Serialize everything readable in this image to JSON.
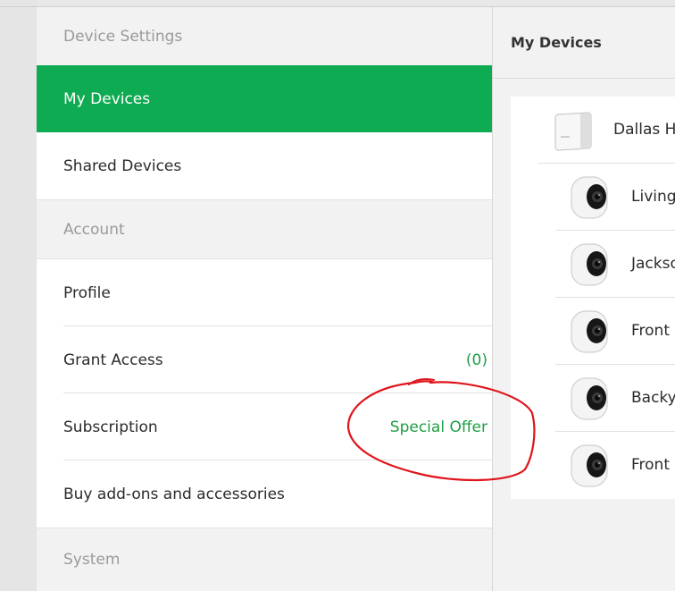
{
  "settings": {
    "sections": [
      {
        "title": "Device Settings"
      },
      {
        "title": "Account"
      },
      {
        "title": "System"
      }
    ],
    "device_items": [
      {
        "label": "My Devices",
        "active": true
      },
      {
        "label": "Shared Devices",
        "active": false
      }
    ],
    "account_items": [
      {
        "label": "Profile",
        "value": ""
      },
      {
        "label": "Grant Access",
        "value": "(0)"
      },
      {
        "label": "Subscription",
        "value": "Special Offer"
      },
      {
        "label": "Buy add-ons and accessories",
        "value": ""
      }
    ]
  },
  "devices": {
    "title": "My Devices",
    "items": [
      {
        "name": "Dallas H",
        "icon": "base-station-icon"
      },
      {
        "name": "Living",
        "icon": "camera-icon"
      },
      {
        "name": "Jackso",
        "icon": "camera-icon"
      },
      {
        "name": "Front",
        "icon": "camera-icon"
      },
      {
        "name": "Backy",
        "icon": "camera-icon"
      },
      {
        "name": "Front",
        "icon": "camera-icon"
      }
    ]
  },
  "colors": {
    "accent_green": "#0fab52",
    "value_green": "#1f9e45",
    "annotation_red": "#e0141b"
  }
}
